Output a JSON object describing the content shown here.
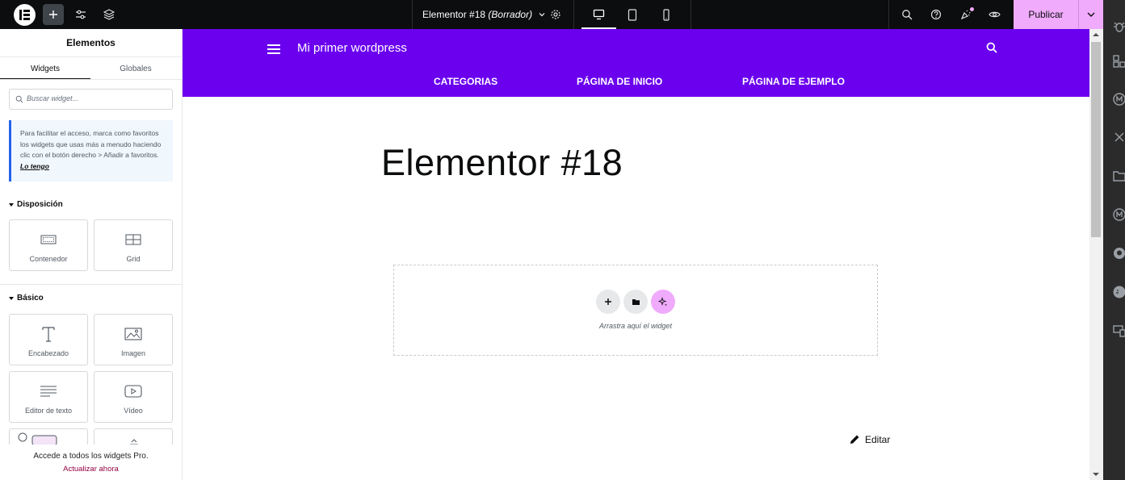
{
  "topbar": {
    "document_title": "Elementor #18",
    "document_status": "(Borrador)",
    "publish_label": "Publicar",
    "icons": [
      "elementor-logo-icon",
      "add-element-icon",
      "site-settings-icon",
      "structure-icon",
      "page-settings-icon",
      "desktop-icon",
      "tablet-icon",
      "mobile-icon",
      "search-icon",
      "help-icon",
      "whats-new-icon",
      "preview-icon",
      "chevron-down-icon"
    ]
  },
  "panel": {
    "title": "Elementos",
    "tabs": [
      {
        "label": "Widgets",
        "active": true
      },
      {
        "label": "Globales",
        "active": false
      }
    ],
    "search_placeholder": "Buscar widget...",
    "notice_text": "Para facilitar el acceso, marca como favoritos los widgets que usas más a menudo haciendo clic con el botón derecho > Añadir a favoritos.",
    "notice_link": "Lo tengo",
    "sections": [
      {
        "title": "Disposición",
        "widgets": [
          {
            "label": "Contenedor",
            "icon": "container-icon"
          },
          {
            "label": "Grid",
            "icon": "grid-icon"
          }
        ]
      },
      {
        "title": "Básico",
        "widgets": [
          {
            "label": "Encabezado",
            "icon": "heading-icon"
          },
          {
            "label": "Imagen",
            "icon": "image-icon"
          },
          {
            "label": "Editor de texto",
            "icon": "text-editor-icon"
          },
          {
            "label": "Vídeo",
            "icon": "video-icon"
          }
        ]
      }
    ],
    "promo_text": "Accede a todos los widgets Pro.",
    "promo_link": "Actualizar ahora"
  },
  "preview": {
    "site_title": "Mi primer wordpress",
    "nav": [
      "CATEGORIAS",
      "PÁGINA DE INICIO",
      "PÁGINA DE EJEMPLO"
    ],
    "page_heading": "Elementor #18",
    "dropzone_text": "Arrastra aquí el widget",
    "edit_label": "Editar"
  },
  "colors": {
    "topbar_bg": "#0c0d0e",
    "publish_bg": "#f0abfc",
    "header_bg": "#6a00ee",
    "notice_border": "#2563eb",
    "promo_link": "#93003f"
  }
}
